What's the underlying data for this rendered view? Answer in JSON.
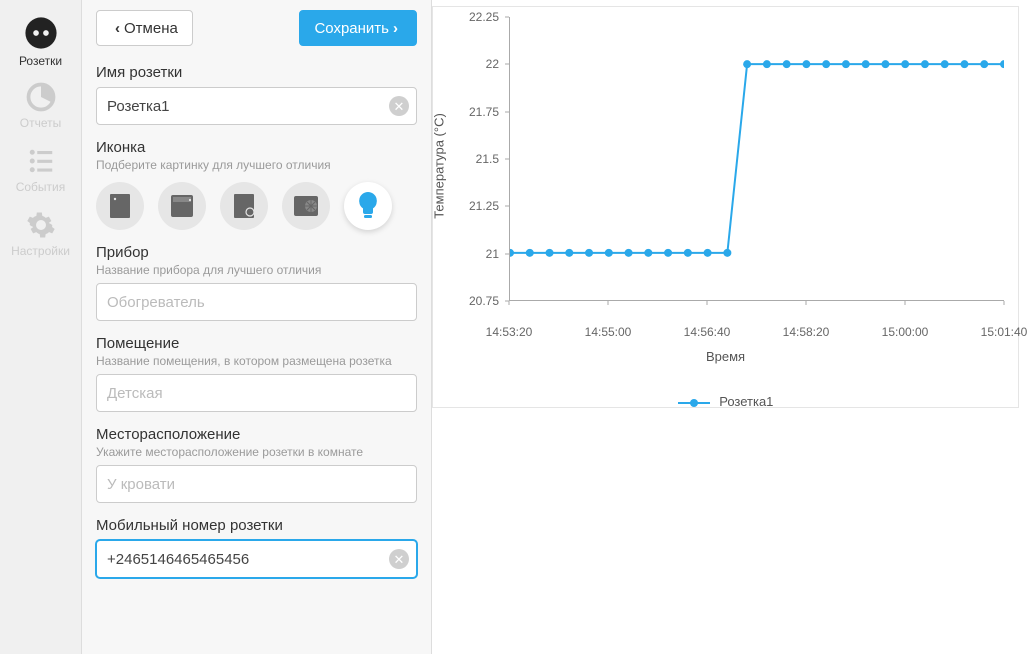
{
  "sidebar": {
    "items": [
      {
        "label": "Розетки",
        "icon": "socket-icon",
        "active": true
      },
      {
        "label": "Отчеты",
        "icon": "reports-icon",
        "active": false
      },
      {
        "label": "События",
        "icon": "events-icon",
        "active": false
      },
      {
        "label": "Настройки",
        "icon": "settings-icon",
        "active": false
      }
    ]
  },
  "toolbar": {
    "cancel_label": "Отмена",
    "save_label": "Сохранить"
  },
  "form": {
    "name_label": "Имя розетки",
    "name_value": "Розетка1",
    "icon_label": "Иконка",
    "icon_help": "Подберите картинку для лучшего отличия",
    "icons": [
      "device-rect-icon",
      "device-box-icon",
      "device-disc-icon",
      "device-fan-icon",
      "bulb-icon"
    ],
    "icon_selected_index": 4,
    "device_label": "Прибор",
    "device_help": "Название прибора для лучшего отличия",
    "device_placeholder": "Обогреватель",
    "device_value": "",
    "room_label": "Помещение",
    "room_help": "Название помещения, в котором размещена розетка",
    "room_placeholder": "Детская",
    "room_value": "",
    "location_label": "Месторасположение",
    "location_help": "Укажите месторасположение розетки в комнате",
    "location_placeholder": "У кровати",
    "location_value": "",
    "phone_label": "Мобильный номер розетки",
    "phone_value": "+2465146465465456"
  },
  "chart_data": {
    "type": "line",
    "title": "",
    "xlabel": "Время",
    "ylabel": "Температура (°C)",
    "ylim": [
      20.75,
      22.25
    ],
    "y_ticks": [
      20.75,
      21,
      21.25,
      21.5,
      21.75,
      22,
      22.25
    ],
    "x_ticks": [
      "14:53:20",
      "14:55:00",
      "14:56:40",
      "14:58:20",
      "15:00:00",
      "15:01:40"
    ],
    "legend": [
      "Розетка1"
    ],
    "colors": {
      "series": "#2aa8ea"
    },
    "series": [
      {
        "name": "Розетка1",
        "x": [
          "14:53:20",
          "14:53:40",
          "14:54:00",
          "14:54:20",
          "14:54:40",
          "14:55:00",
          "14:55:20",
          "14:55:40",
          "14:56:00",
          "14:56:20",
          "14:56:40",
          "14:57:00",
          "14:57:20",
          "14:57:40",
          "14:58:00",
          "14:58:20",
          "14:58:40",
          "14:59:00",
          "14:59:20",
          "14:59:40",
          "15:00:00",
          "15:00:20",
          "15:00:40",
          "15:01:00",
          "15:01:20",
          "15:01:40"
        ],
        "values": [
          21,
          21,
          21,
          21,
          21,
          21,
          21,
          21,
          21,
          21,
          21,
          21,
          22,
          22,
          22,
          22,
          22,
          22,
          22,
          22,
          22,
          22,
          22,
          22,
          22,
          22
        ]
      }
    ]
  }
}
